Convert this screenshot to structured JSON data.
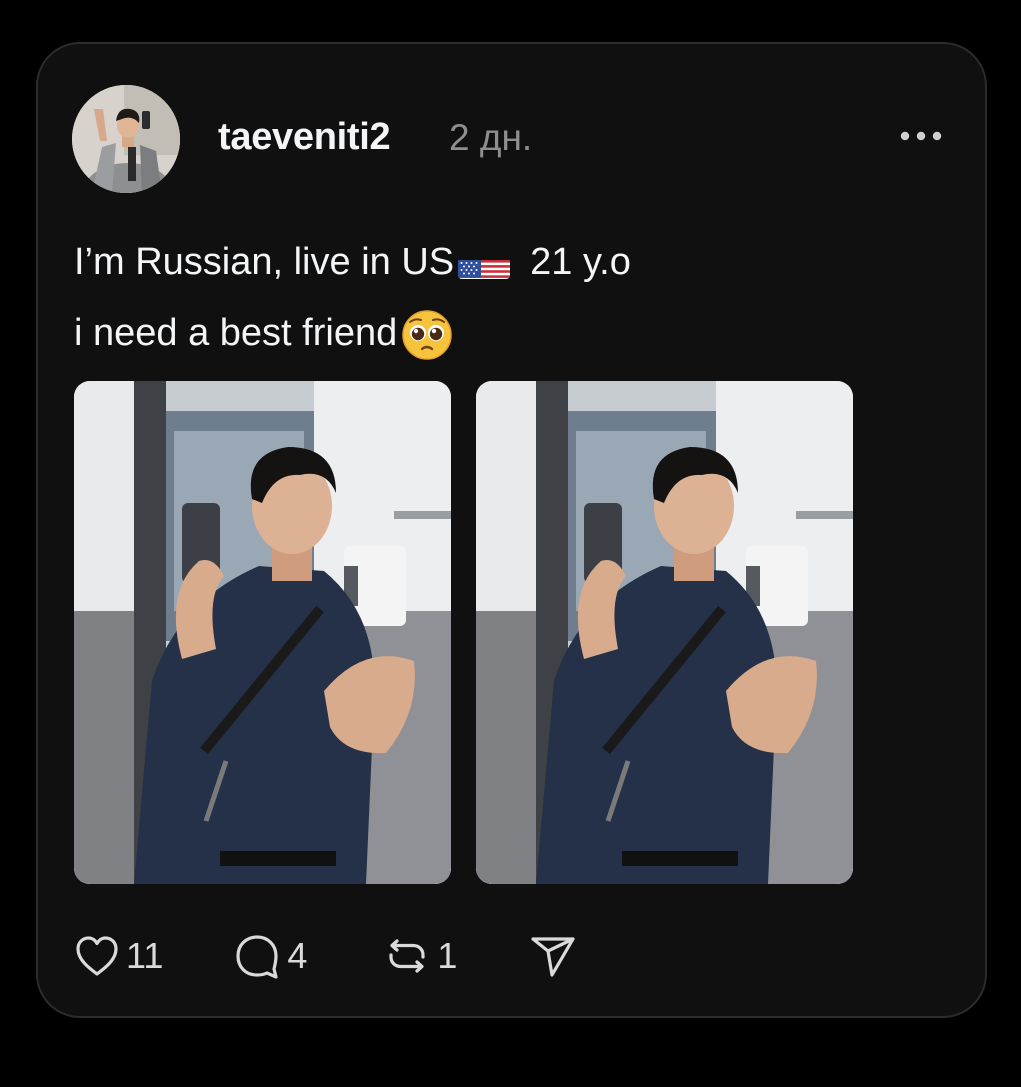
{
  "post": {
    "author": {
      "username": "taeveniti2",
      "avatar_icon": "profile-photo"
    },
    "timestamp": "2 дн.",
    "more_icon": "ellipsis-icon",
    "text_line1": "I’m Russian, live in US",
    "text_line1_suffix": "21 y.o",
    "text_line1_emoji": "us-flag-emoji",
    "text_line2": "i need a best friend",
    "text_line2_emoji": "pleading-face-emoji",
    "media": [
      {
        "type": "photo",
        "subject": "mirror-selfie"
      },
      {
        "type": "photo",
        "subject": "mirror-selfie"
      }
    ],
    "actions": {
      "likes": "11",
      "comments": "4",
      "reposts": "1",
      "like_icon": "heart-icon",
      "comment_icon": "speech-bubble-icon",
      "repost_icon": "repost-icon",
      "share_icon": "send-icon"
    }
  },
  "colors": {
    "background": "#000000",
    "card": "#101010",
    "card_border": "#2c2c2c",
    "text_primary": "#f3f5f7",
    "text_secondary": "#8e8e8e"
  }
}
